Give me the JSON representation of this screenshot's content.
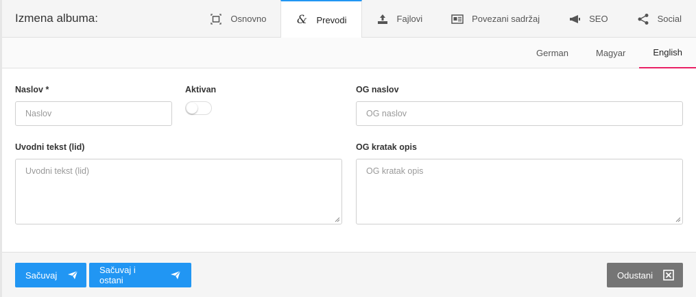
{
  "header": {
    "title": "Izmena albuma:",
    "tabs": [
      {
        "label": "Osnovno",
        "icon": "expand-icon"
      },
      {
        "label": "Prevodi",
        "icon": "ampersand-icon",
        "active": true
      },
      {
        "label": "Fajlovi",
        "icon": "upload-icon"
      },
      {
        "label": "Povezani sadržaj",
        "icon": "newspaper-icon"
      },
      {
        "label": "SEO",
        "icon": "megaphone-icon"
      },
      {
        "label": "Social",
        "icon": "share-icon"
      }
    ]
  },
  "languages": [
    {
      "label": "German"
    },
    {
      "label": "Magyar"
    },
    {
      "label": "English",
      "active": true
    }
  ],
  "form": {
    "title_label": "Naslov *",
    "title_placeholder": "Naslov",
    "active_label": "Aktivan",
    "active_value": false,
    "og_title_label": "OG naslov",
    "og_title_placeholder": "OG naslov",
    "lead_label": "Uvodni tekst (lid)",
    "lead_placeholder": "Uvodni tekst (lid)",
    "og_desc_label": "OG kratak opis",
    "og_desc_placeholder": "OG kratak opis"
  },
  "footer": {
    "save_label": "Sačuvaj",
    "save_stay_label": "Sačuvaj i ostani",
    "cancel_label": "Odustani"
  },
  "colors": {
    "primary": "#2196f3",
    "active_tab_border": "#2196f3",
    "active_lang_border": "#e91e63",
    "cancel": "#757575"
  }
}
